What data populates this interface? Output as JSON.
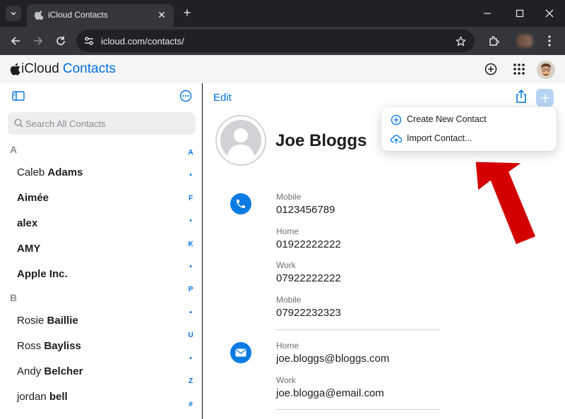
{
  "browser": {
    "tab_title": "iCloud Contacts",
    "url": "icloud.com/contacts/"
  },
  "app": {
    "brand": "iCloud",
    "product": "Contacts"
  },
  "sidebar": {
    "search_placeholder": "Search All Contacts",
    "sections": [
      {
        "letter": "A",
        "contacts": [
          {
            "first": "Caleb",
            "last": "Adams"
          },
          {
            "first": "",
            "last": "Aimée"
          },
          {
            "first": "",
            "last": "alex"
          },
          {
            "first": "",
            "last": "AMY"
          },
          {
            "first": "",
            "last": "Apple Inc."
          }
        ]
      },
      {
        "letter": "B",
        "contacts": [
          {
            "first": "Rosie",
            "last": "Baillie"
          },
          {
            "first": "Ross",
            "last": "Bayliss"
          },
          {
            "first": "Andy",
            "last": "Belcher"
          },
          {
            "first": "jordan",
            "last": "bell"
          }
        ]
      }
    ],
    "index": [
      "A",
      "•",
      "F",
      "•",
      "K",
      "•",
      "P",
      "•",
      "U",
      "•",
      "Z",
      "#"
    ]
  },
  "detail": {
    "edit_label": "Edit",
    "name": "Joe Bloggs",
    "phones": [
      {
        "label": "Mobile",
        "value": "0123456789"
      },
      {
        "label": "Home",
        "value": "01922222222"
      },
      {
        "label": "Work",
        "value": "07922222222"
      },
      {
        "label": "Mobile",
        "value": "07922232323"
      }
    ],
    "emails": [
      {
        "label": "Home",
        "value": "joe.bloggs@bloggs.com"
      },
      {
        "label": "Work",
        "value": "joe.blogga@email.com"
      }
    ]
  },
  "dropdown": {
    "create_label": "Create New Contact",
    "import_label": "Import Contact..."
  },
  "colors": {
    "accent": "#0071e3",
    "annotation_arrow": "#d40000"
  }
}
